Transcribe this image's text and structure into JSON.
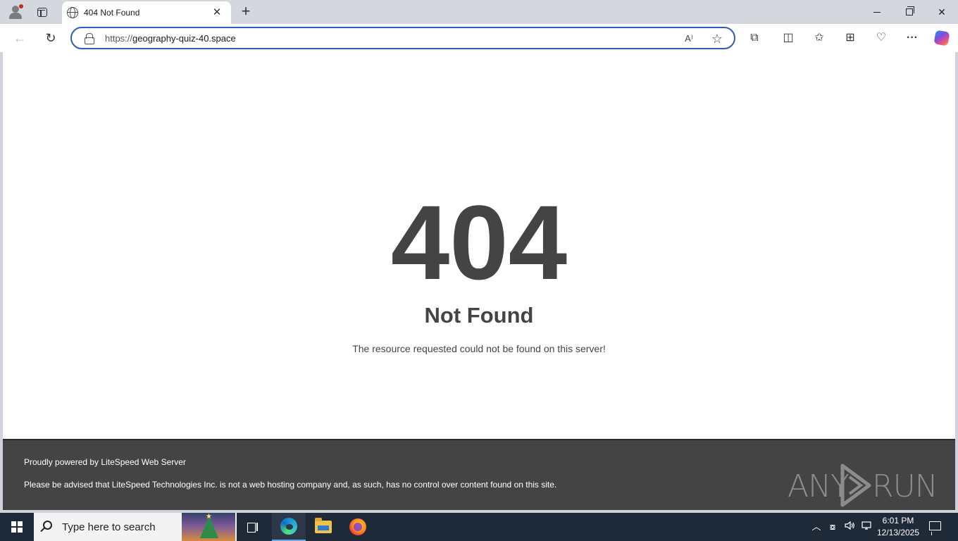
{
  "browser": {
    "tab": {
      "title": "404 Not Found"
    },
    "address_bar": {
      "url_scheme": "https://",
      "url_host": "geography-quiz-40.space"
    },
    "icons": {
      "profile": "profile-icon",
      "tab_actions": "tab-actions-icon",
      "tab_favicon": "globe-icon",
      "tab_close": "close-icon",
      "new_tab": "plus-icon",
      "back": "arrow-left-icon",
      "refresh": "refresh-icon",
      "lock": "lock-icon",
      "read_aloud": "read-aloud-icon",
      "favorite": "star-icon",
      "extensions": "puzzle-icon",
      "split_screen": "split-screen-icon",
      "favorites": "favorites-icon",
      "collections": "collections-icon",
      "performance": "heartbeat-icon",
      "more": "ellipsis-icon",
      "copilot": "copilot-icon"
    },
    "glyphs": {
      "close": "✕",
      "new_tab": "+",
      "back": "←",
      "refresh": "↻",
      "read_aloud": "A⁾",
      "favorite": "☆",
      "extensions": "⧉",
      "split_screen": "◫",
      "favorites": "✩",
      "collections": "⊞",
      "performance": "♡",
      "more": "···"
    },
    "accent_color": "#2d5eb8"
  },
  "page": {
    "error_code": "404",
    "error_title": "Not Found",
    "error_message": "The resource requested could not be found on this server!",
    "footer": {
      "line1": "Proudly powered by LiteSpeed Web Server",
      "line2": "Please be advised that LiteSpeed Technologies Inc. is not a web hosting company and, as such, has no control over content found on this site."
    },
    "text_color": "#444444",
    "footer_bg": "#444444"
  },
  "watermark": {
    "left": "ANY",
    "right": "RUN"
  },
  "taskbar": {
    "search_placeholder": "Type here to search",
    "clock_time": "6:01 PM",
    "clock_date": "12/13/2025",
    "apps": [
      "task-view-icon",
      "edge-icon",
      "file-explorer-icon",
      "firefox-icon"
    ],
    "tray_glyphs": {
      "chevron": "︿",
      "meet": "⧇",
      "volume": "🔊",
      "network": "▭"
    }
  }
}
